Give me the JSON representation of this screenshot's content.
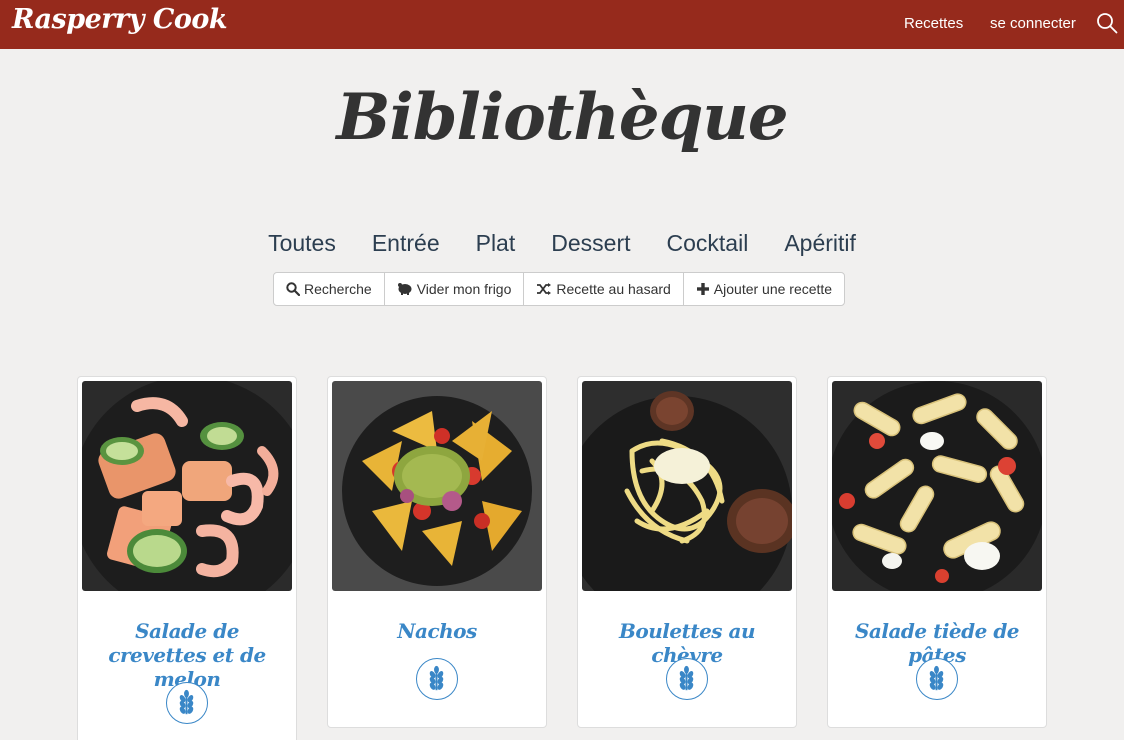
{
  "navbar": {
    "brand": "Rasperry Cook",
    "links": [
      "Recettes",
      "se connecter"
    ],
    "search_icon": "search-icon"
  },
  "page_title": "Bibliothèque",
  "categories": [
    "Toutes",
    "Entrée",
    "Plat",
    "Dessert",
    "Cocktail",
    "Apéritif"
  ],
  "actions": [
    {
      "icon": "search-icon",
      "label": "Recherche"
    },
    {
      "icon": "fridge-icon",
      "label": "Vider mon frigo"
    },
    {
      "icon": "shuffle-icon",
      "label": "Recette au hasard"
    },
    {
      "icon": "plus-icon",
      "label": "Ajouter une recette"
    }
  ],
  "recipes": [
    {
      "title": "Salade de crevettes et de melon",
      "badge_icon": "wheat-icon"
    },
    {
      "title": "Nachos",
      "badge_icon": "wheat-icon"
    },
    {
      "title": "Boulettes au chèvre",
      "badge_icon": "wheat-icon"
    },
    {
      "title": "Salade tiède de pâtes",
      "badge_icon": "wheat-icon"
    }
  ],
  "colors": {
    "navbar_bg": "#962a1c",
    "page_bg": "#f1f0ef",
    "recipe_title": "#3a87c7",
    "title_text": "#333333"
  }
}
